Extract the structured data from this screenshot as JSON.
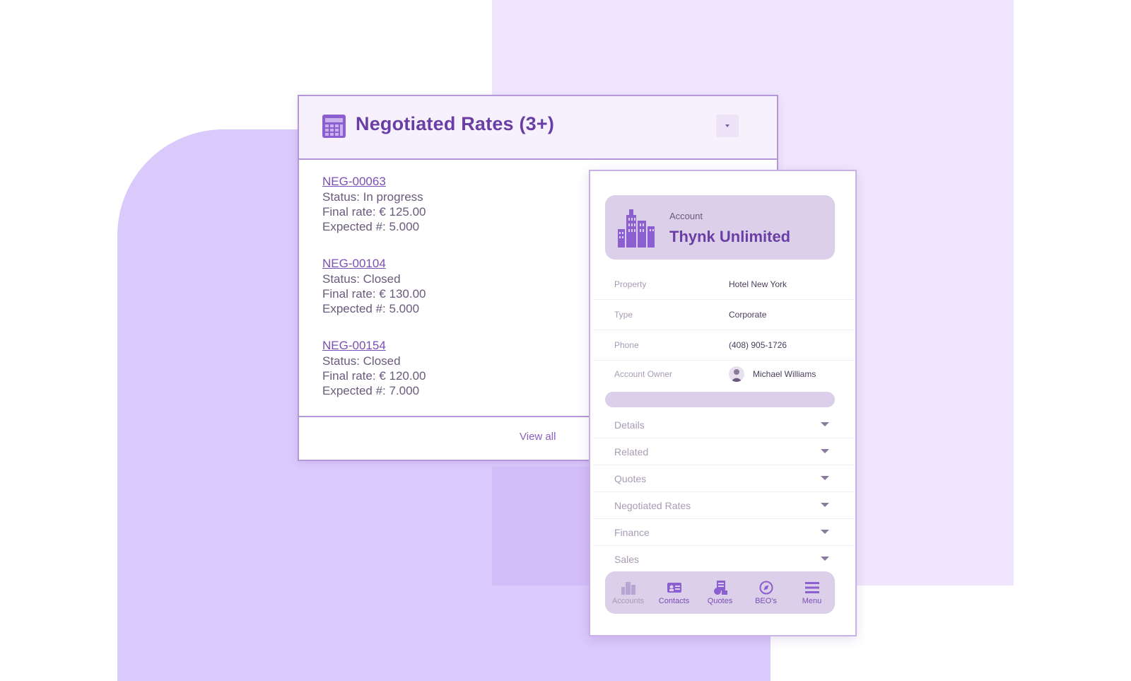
{
  "negotiated_rates": {
    "title": "Negotiated Rates (3+)",
    "items": [
      {
        "id": "NEG-00063",
        "status": "Status: In progress",
        "final_rate": "Final rate: € 125.00",
        "expected": "Expected #: 5.000"
      },
      {
        "id": "NEG-00104",
        "status": "Status: Closed",
        "final_rate": "Final rate: € 130.00",
        "expected": "Expected #: 5.000"
      },
      {
        "id": "NEG-00154",
        "status": "Status: Closed",
        "final_rate": "Final rate: € 120.00",
        "expected": "Expected #: 7.000"
      }
    ],
    "view_all": "View all"
  },
  "account": {
    "label": "Account",
    "name": "Thynk Unlimited",
    "fields": [
      {
        "label": "Property",
        "value": "Hotel New York"
      },
      {
        "label": "Type",
        "value": "Corporate"
      },
      {
        "label": "Phone",
        "value": "(408) 905-1726"
      },
      {
        "label": "Account Owner",
        "value": "Michael Williams"
      }
    ],
    "sections": [
      "Details",
      "Related",
      "Quotes",
      "Negotiated Rates",
      "Finance",
      "Sales"
    ],
    "nav": [
      {
        "label": "Accounts",
        "icon": "building-icon",
        "active": false
      },
      {
        "label": "Contacts",
        "icon": "contact-card-icon",
        "active": true
      },
      {
        "label": "Quotes",
        "icon": "quotes-icon",
        "active": true
      },
      {
        "label": "BEO's",
        "icon": "compass-icon",
        "active": true
      },
      {
        "label": "Menu",
        "icon": "menu-icon",
        "active": true
      }
    ]
  },
  "colors": {
    "accent": "#6a3fa5",
    "lavender_bg": "#efe6fd",
    "purple_bg": "#dac9fb",
    "header_fill": "#dccfe9"
  }
}
